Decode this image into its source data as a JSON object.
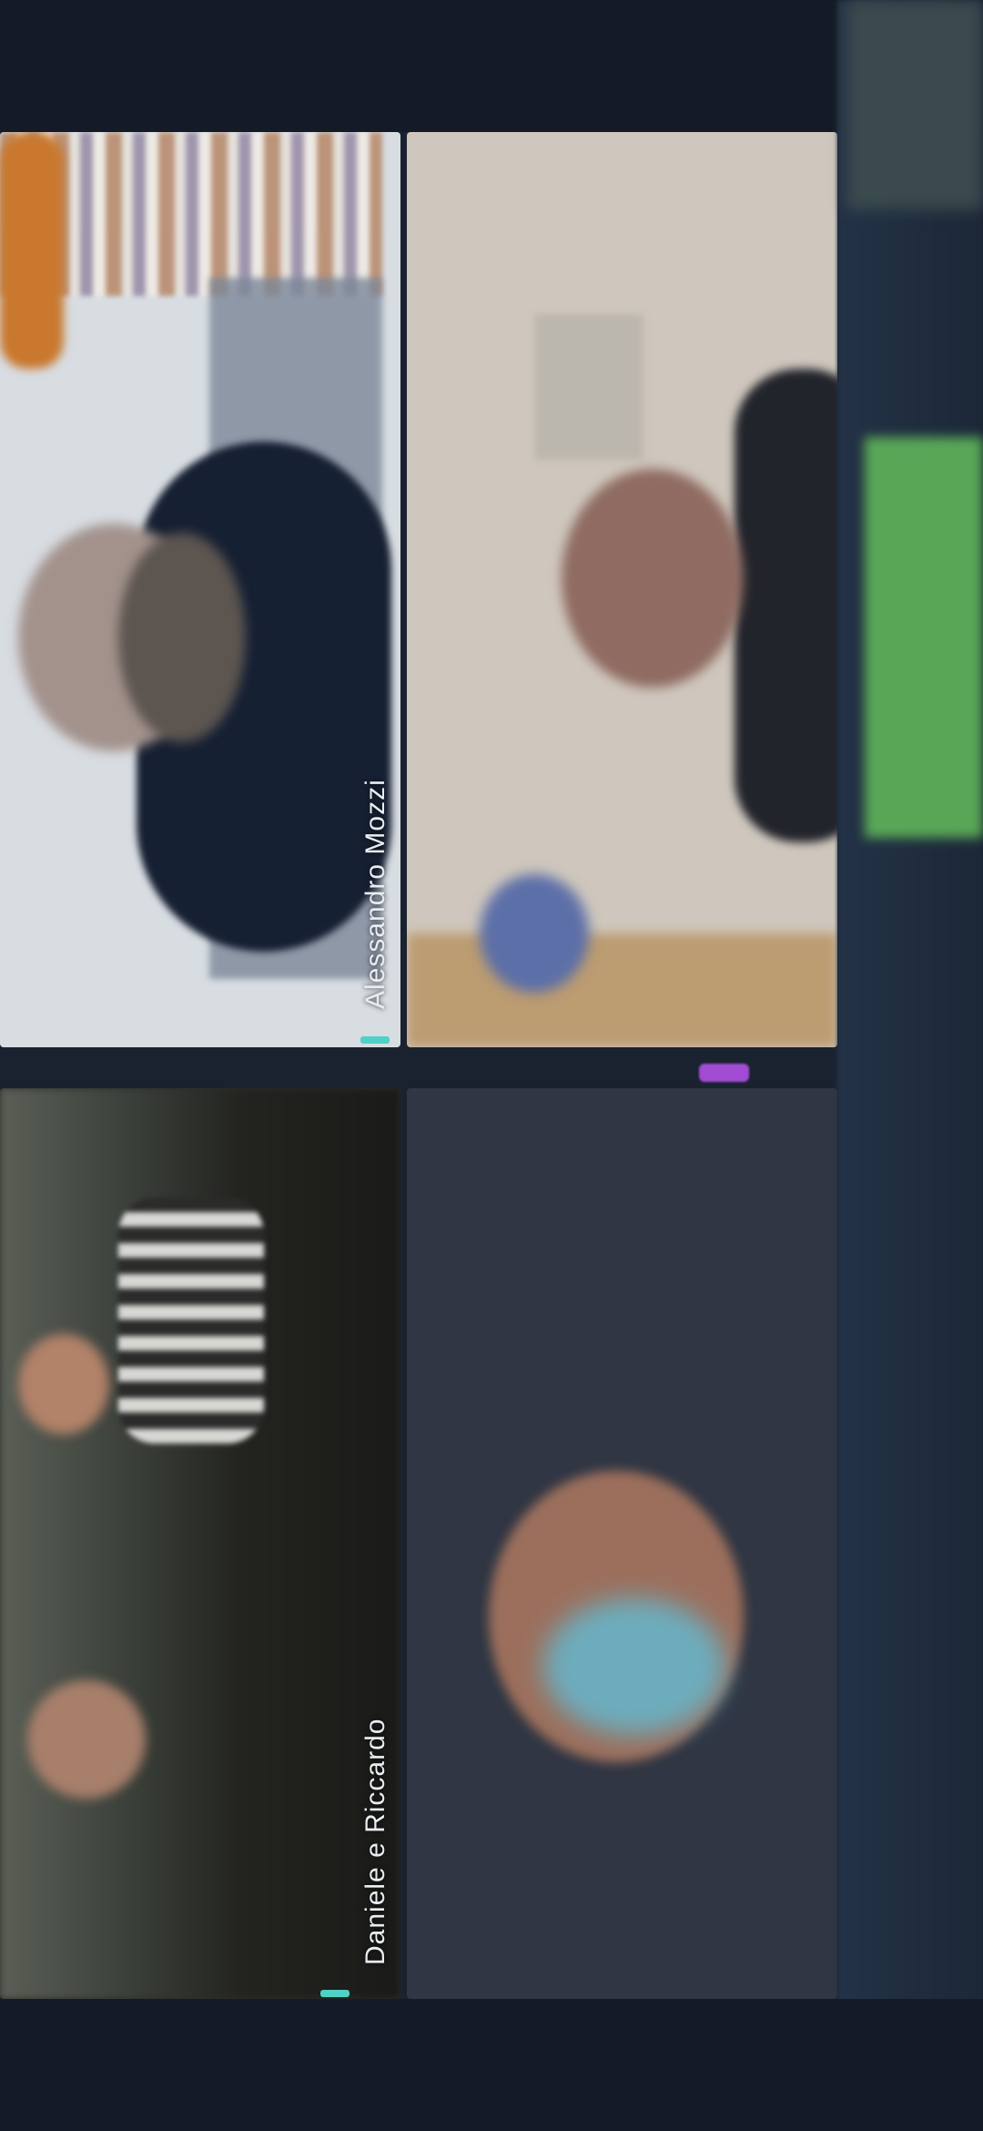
{
  "call": {
    "participants": [
      {
        "name": "Alessandro Mozzi",
        "speaking": true
      },
      {
        "name": "",
        "speaking": false
      },
      {
        "name": "Daniele e Riccardo",
        "speaking": true
      },
      {
        "name": "",
        "speaking": false
      }
    ]
  },
  "colors": {
    "speaking_indicator": "#4fd1c5",
    "badge": "#a24bd4",
    "background": "#1a2230"
  },
  "icons": {
    "tile_badge": "participant-badge-icon"
  }
}
